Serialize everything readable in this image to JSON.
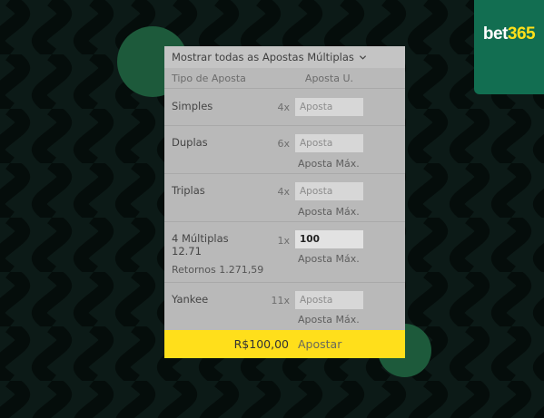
{
  "brand": {
    "logo_bet": "bet",
    "logo_num": "365",
    "bg_color": "#0c1a17",
    "accent_green": "#126e51",
    "accent_yellow": "#ffdf1b"
  },
  "panel": {
    "header_label": "Mostrar todas as Apostas Múltiplas",
    "header_icon": "chevron-down-icon",
    "col_type": "Tipo de Aposta",
    "col_stake": "Aposta U.",
    "rows": [
      {
        "label": "Simples",
        "multiplier": "4x",
        "placeholder": "Aposta",
        "value": ""
      },
      {
        "label": "Duplas",
        "multiplier": "6x",
        "placeholder": "Aposta",
        "value": "",
        "max_label": "Aposta Máx."
      },
      {
        "label": "Triplas",
        "multiplier": "4x",
        "placeholder": "Aposta",
        "value": "",
        "max_label": "Aposta Máx."
      },
      {
        "label": "4 Múltiplas",
        "odds": "12.71",
        "returns": "Retornos 1.271,59",
        "multiplier": "1x",
        "placeholder": "Aposta",
        "value": "100",
        "max_label": "Aposta Máx."
      },
      {
        "label": "Yankee",
        "multiplier": "11x",
        "placeholder": "Aposta",
        "value": "",
        "max_label": "Aposta Máx."
      }
    ],
    "footer": {
      "total": "R$100,00",
      "button_label": "Apostar"
    }
  }
}
